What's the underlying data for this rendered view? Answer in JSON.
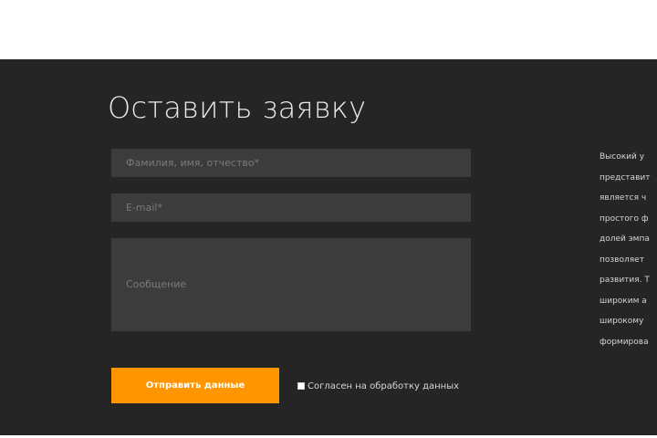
{
  "form": {
    "title": "Оставить заявку",
    "name_placeholder": "Фамилия, имя, отчество*",
    "email_placeholder": "E-mail*",
    "message_placeholder": "Сообщение",
    "submit_label": "Отправить данные",
    "consent_label": "Согласен на обработку данных",
    "consent_checked": false
  },
  "side_text": {
    "lines": [
      "Высокий у",
      "представит",
      "является ч",
      "простого ф",
      "долей эмпа",
      "позволяет",
      "развития. Т",
      "широким а",
      "широкому",
      "формирова"
    ]
  },
  "colors": {
    "section_background": "#252525",
    "field_background": "#3c3c3c",
    "accent": "#ff9600",
    "title_text": "#e9e9e9"
  }
}
